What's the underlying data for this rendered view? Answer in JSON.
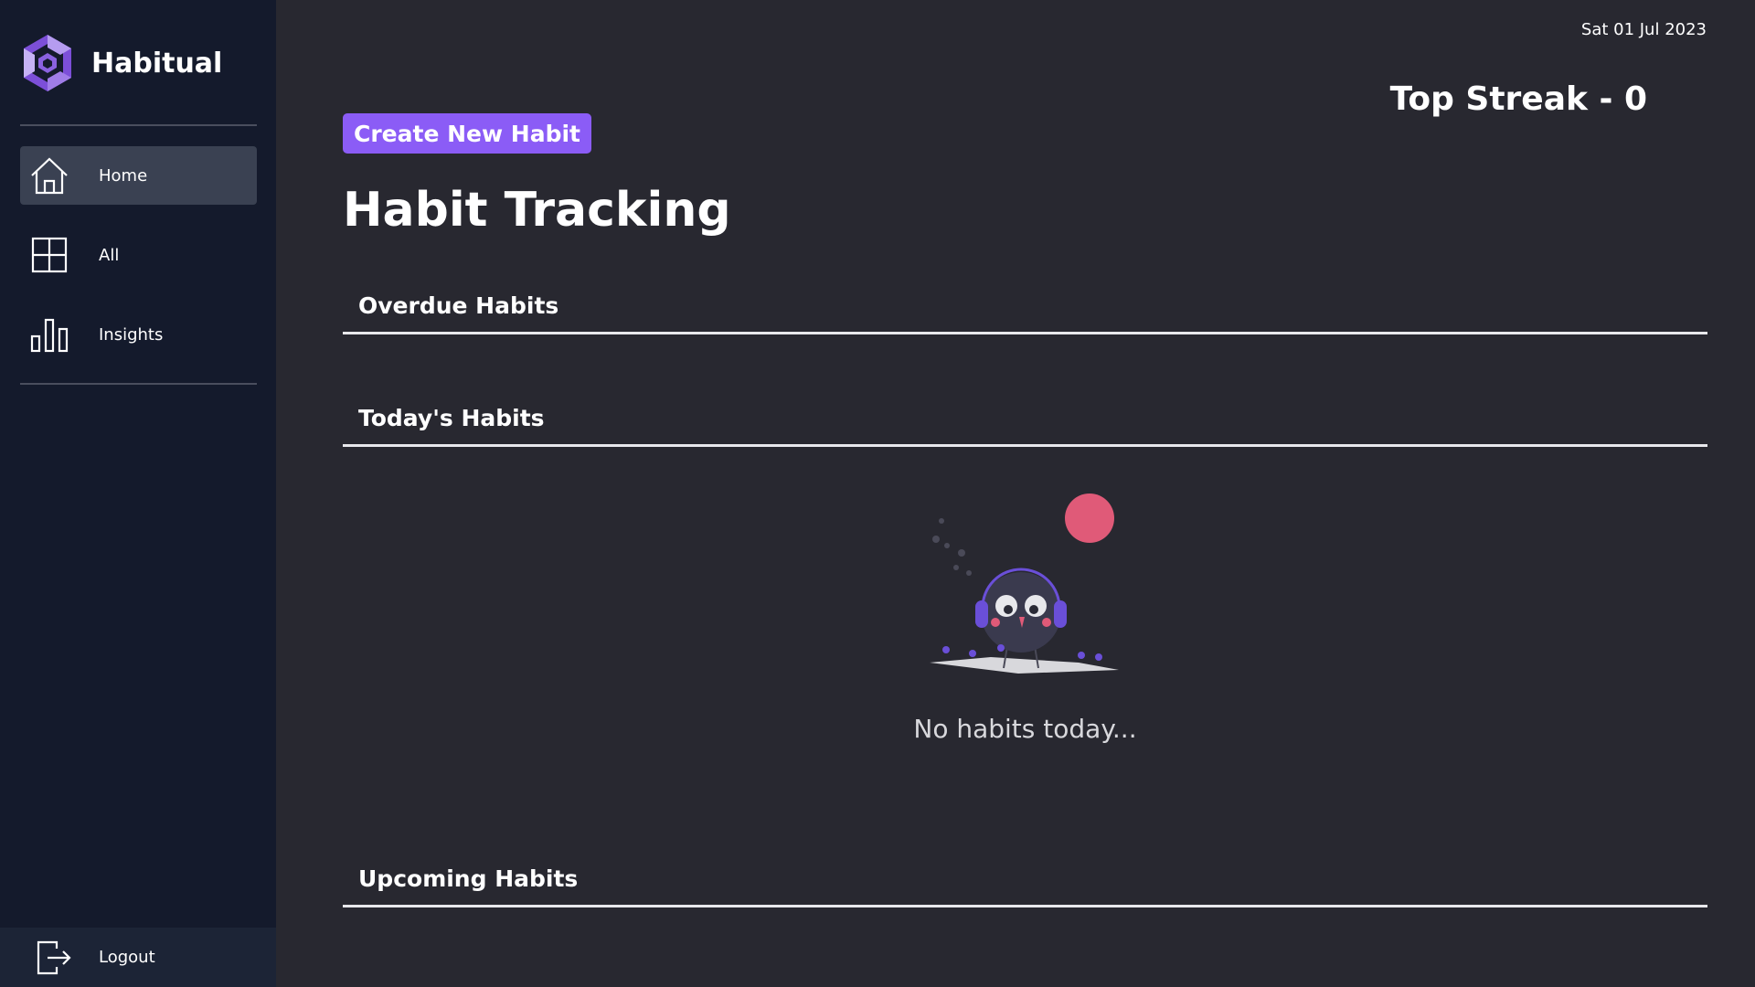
{
  "app": {
    "name": "Habitual"
  },
  "sidebar": {
    "items": [
      {
        "label": "Home",
        "icon": "home-icon",
        "active": true
      },
      {
        "label": "All",
        "icon": "grid-icon",
        "active": false
      },
      {
        "label": "Insights",
        "icon": "bar-chart-icon",
        "active": false
      }
    ],
    "logout": {
      "label": "Logout",
      "icon": "logout-icon"
    }
  },
  "header": {
    "date": "Sat 01 Jul 2023",
    "top_streak": "Top Streak - 0",
    "create_button": "Create New Habit",
    "title": "Habit Tracking"
  },
  "sections": {
    "overdue": "Overdue Habits",
    "today": "Today's Habits",
    "upcoming": "Upcoming Habits"
  },
  "empty_state": {
    "text": "No habits today..."
  },
  "colors": {
    "accent": "#8b5cf6",
    "sidebar_bg": "#141a2c",
    "main_bg": "#282830",
    "illustration_sun": "#e05a78",
    "illustration_headphones": "#6a4fd8"
  }
}
